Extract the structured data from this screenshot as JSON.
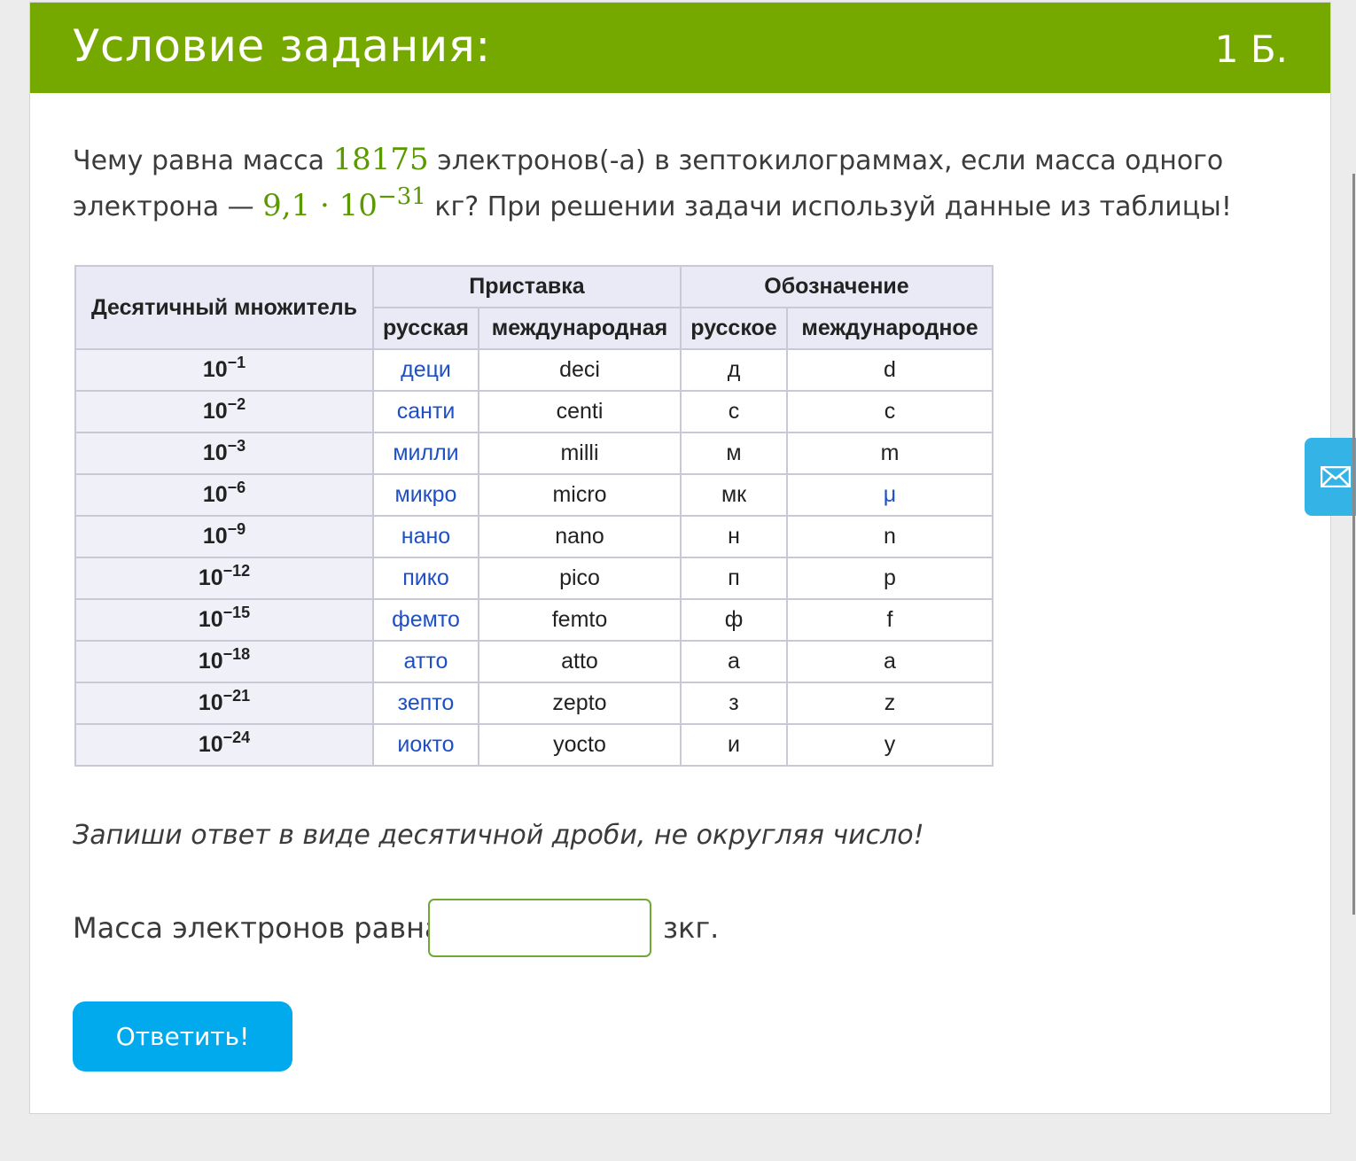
{
  "header": {
    "title": "Условие задания:",
    "points": "1 Б."
  },
  "question": {
    "part1": "Чему равна масса",
    "count": "18175",
    "part2": "электронов(-а) в зептокилограммах, если масса одного электрона —",
    "mass_mantissa": "9,1 · 10",
    "mass_exponent": "−31",
    "part3": "кг? При решении задачи используй данные из таблицы!"
  },
  "table": {
    "headers": {
      "multiplier": "Десятичный множитель",
      "prefix": "Приставка",
      "designation": "Обозначение",
      "prefix_ru": "русская",
      "prefix_intl": "международная",
      "desig_ru": "русское",
      "desig_intl": "международное"
    },
    "rows": [
      {
        "base": "10",
        "exp": "−1",
        "ru": "деци",
        "intl": "deci",
        "sym_ru": "д",
        "sym_intl": "d"
      },
      {
        "base": "10",
        "exp": "−2",
        "ru": "санти",
        "intl": "centi",
        "sym_ru": "с",
        "sym_intl": "c"
      },
      {
        "base": "10",
        "exp": "−3",
        "ru": "милли",
        "intl": "milli",
        "sym_ru": "м",
        "sym_intl": "m"
      },
      {
        "base": "10",
        "exp": "−6",
        "ru": "микро",
        "intl": "micro",
        "sym_ru": "мк",
        "sym_intl": "μ"
      },
      {
        "base": "10",
        "exp": "−9",
        "ru": "нано",
        "intl": "nano",
        "sym_ru": "н",
        "sym_intl": "n"
      },
      {
        "base": "10",
        "exp": "−12",
        "ru": "пико",
        "intl": "pico",
        "sym_ru": "п",
        "sym_intl": "p"
      },
      {
        "base": "10",
        "exp": "−15",
        "ru": "фемто",
        "intl": "femto",
        "sym_ru": "ф",
        "sym_intl": "f"
      },
      {
        "base": "10",
        "exp": "−18",
        "ru": "атто",
        "intl": "atto",
        "sym_ru": "а",
        "sym_intl": "a"
      },
      {
        "base": "10",
        "exp": "−21",
        "ru": "зепто",
        "intl": "zepto",
        "sym_ru": "з",
        "sym_intl": "z"
      },
      {
        "base": "10",
        "exp": "−24",
        "ru": "иокто",
        "intl": "yocto",
        "sym_ru": "и",
        "sym_intl": "y"
      }
    ]
  },
  "instruction": "Запиши ответ в виде десятичной дроби, не округляя число!",
  "answer": {
    "label": "Масса электронов равна",
    "value": "",
    "unit": "зкг."
  },
  "submit_label": "Ответить!",
  "colors": {
    "header_bg": "#76a900",
    "math": "#5a9a00",
    "button": "#00aaec",
    "link": "#1e4fc4"
  },
  "icons": {
    "feedback": "envelope-icon"
  }
}
